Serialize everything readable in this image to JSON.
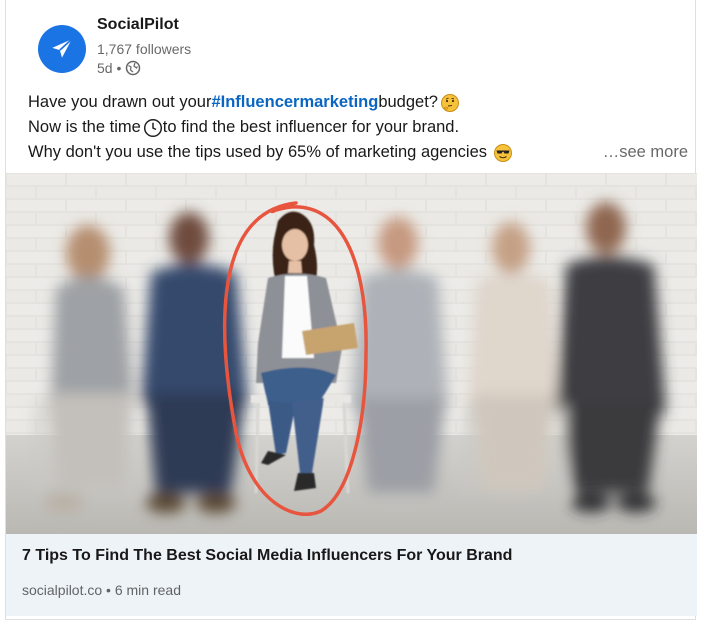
{
  "post": {
    "company": "SocialPilot",
    "followers": "1,767 followers",
    "time": "5d •",
    "text": {
      "line1_pre": "Have you drawn out your ",
      "hashtag": "#Influencermarketing",
      "line1_post": " budget?",
      "line2_pre": "Now is the time",
      "line2_post": " to find the best influencer for your brand.",
      "line3": "Why don't you use the tips used by 65% of marketing agencies",
      "see_more": "…see more"
    },
    "emojis": [
      "thinking-face",
      "clock",
      "smiling-face-with-sunglasses"
    ]
  },
  "link": {
    "title": "7 Tips To Find The Best Social Media Influencers For Your Brand",
    "source": "socialpilot.co • 6 min read"
  },
  "colors": {
    "brand": "#1b74e4",
    "hashtag": "#0a66c2",
    "highlight_circle": "#e8553f",
    "footer_bg": "#eef3f8"
  }
}
